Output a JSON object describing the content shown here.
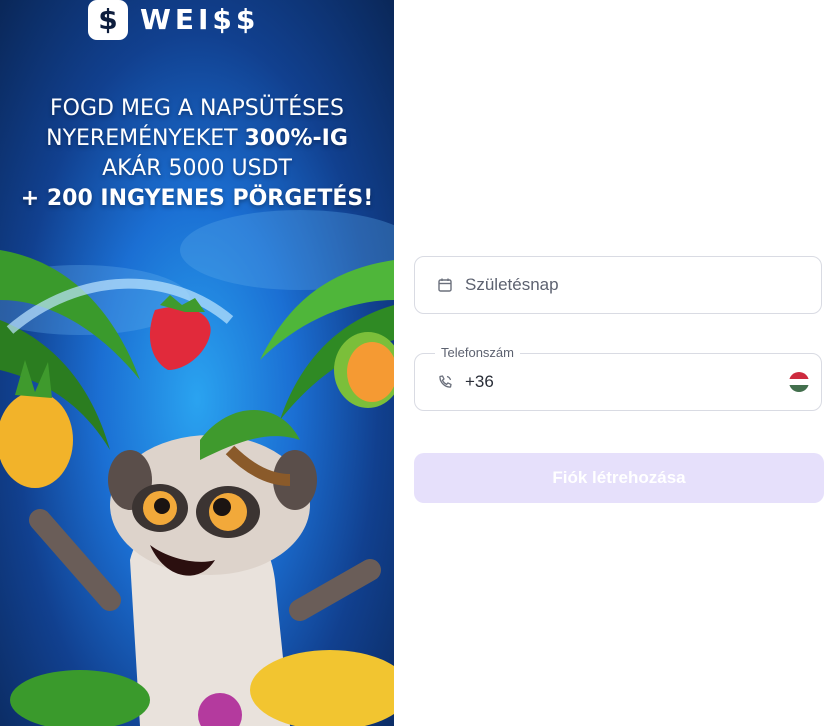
{
  "brand": {
    "logo_glyph": "$",
    "name": "WEI$$"
  },
  "promo": {
    "line1": "FOGD MEG A NAPSÜTÉSES",
    "line2_text": "NYEREMÉNYEKET ",
    "line2_bold": "300%-IG",
    "line3": "AKÁR 5000 USDT",
    "line4": "+ 200 INGYENES PÖRGETÉS!"
  },
  "form": {
    "birthday_placeholder": "Születésnap",
    "phone_label": "Telefonszám",
    "phone_prefix": "+36",
    "flag_country": "hungary",
    "submit_label": "Fiók létrehozása"
  },
  "colors": {
    "submit_bg_disabled": "#e6e0fb",
    "input_border": "#d9dbe3",
    "flag_red": "#cd2a3e",
    "flag_white": "#ffffff",
    "flag_green": "#436f4d"
  },
  "icons": {
    "birthday": "calendar-icon",
    "phone": "phone-icon",
    "flag": "hungary-flag-icon"
  }
}
